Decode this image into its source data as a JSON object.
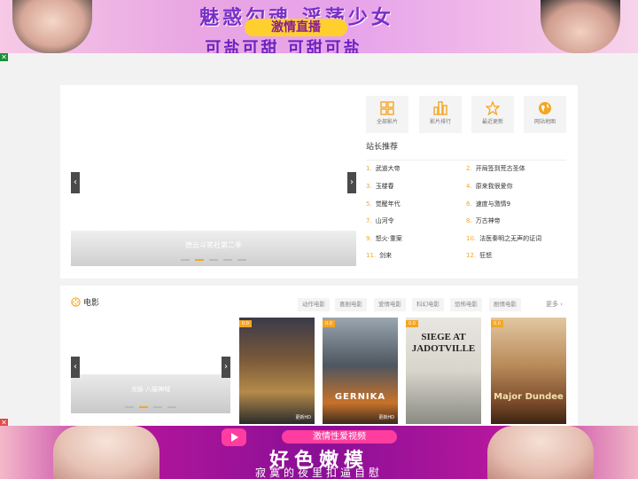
{
  "ads": {
    "top": {
      "line1": "魅惑勾魂 淫荡少女",
      "badge": "激情直播",
      "line2": "可盐可甜 可甜可盐"
    },
    "bottom": {
      "sub": "激情性爱视频",
      "big": "好色嫩模",
      "small": "寂寞的夜里扣逼自慰"
    },
    "close": "✕"
  },
  "hero": {
    "caption": "德云斗笑社第二季",
    "prev": "‹",
    "next": "›"
  },
  "quick_nav": [
    {
      "label": "全部影片",
      "icon": "grid-icon"
    },
    {
      "label": "影片排行",
      "icon": "bar-chart-icon"
    },
    {
      "label": "最近更新",
      "icon": "star-icon"
    },
    {
      "label": "网站地图",
      "icon": "globe-icon"
    }
  ],
  "recommend": {
    "title": "站长推荐",
    "items": [
      {
        "n": "1.",
        "title": "武道大帝"
      },
      {
        "n": "2.",
        "title": "开局签到荒古圣体"
      },
      {
        "n": "3.",
        "title": "玉楼春"
      },
      {
        "n": "4.",
        "title": "原来我很爱你"
      },
      {
        "n": "5.",
        "title": "觉醒年代"
      },
      {
        "n": "6.",
        "title": "速度与激情9"
      },
      {
        "n": "7.",
        "title": "山河令"
      },
      {
        "n": "8.",
        "title": "万古神帝"
      },
      {
        "n": "9.",
        "title": "怒火·重案"
      },
      {
        "n": "10.",
        "title": "法医秦明之无声的证词"
      },
      {
        "n": "11.",
        "title": "剑来"
      },
      {
        "n": "12.",
        "title": "狂怒"
      }
    ]
  },
  "movies": {
    "title": "电影",
    "categories": [
      "动作电影",
      "喜剧电影",
      "爱情电影",
      "科幻电影",
      "恐怖电影",
      "剧情电影"
    ],
    "more": "更多 ›",
    "slider_caption": "龙脉·八猫神域",
    "posters": [
      {
        "tag": "0.0",
        "text": "",
        "foot": "更新HD"
      },
      {
        "tag": "0.0",
        "text": "GERNIKA",
        "foot": "更新HD"
      },
      {
        "tag": "0.0",
        "text": "SIEGE AT JADOTVILLE",
        "foot": ""
      },
      {
        "tag": "0.0",
        "text": "Major Dundee",
        "foot": ""
      }
    ]
  },
  "colors": {
    "accent": "#f5a623",
    "panel": "#ffffff",
    "page_bg": "#f2f2f2"
  }
}
